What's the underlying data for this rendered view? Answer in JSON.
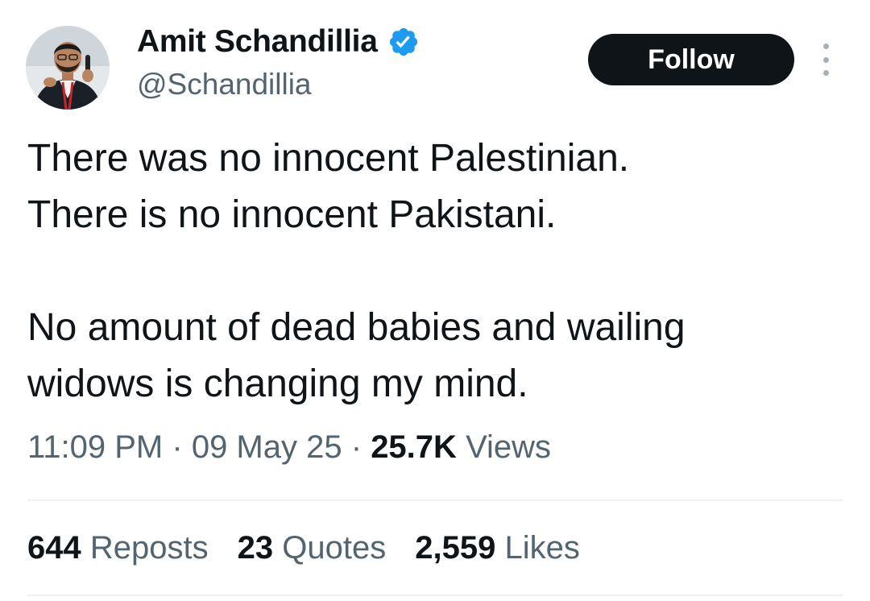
{
  "author": {
    "display_name": "Amit Schandillia",
    "handle": "@Schandillia",
    "verified": true
  },
  "follow_label": "Follow",
  "tweet": {
    "lines": [
      "There was no innocent Palestinian.",
      "There is no innocent Pakistani.",
      "No amount of dead babies and wailing",
      "widows is changing my mind."
    ]
  },
  "meta": {
    "time": "11:09 PM",
    "separator": "·",
    "date": "09 May 25",
    "views_count": "25.7K",
    "views_label": "Views"
  },
  "stats": {
    "reposts": {
      "count": "644",
      "label": "Reposts"
    },
    "quotes": {
      "count": "23",
      "label": "Quotes"
    },
    "likes": {
      "count": "2,559",
      "label": "Likes"
    }
  },
  "colors": {
    "text_primary": "#0f1419",
    "text_secondary": "#536471",
    "verified_blue": "#1d9bf0",
    "follow_bg": "#0f1419",
    "divider": "#eff3f4"
  },
  "icons": [
    "avatar-photo",
    "verified-badge-icon",
    "more-options-icon"
  ]
}
